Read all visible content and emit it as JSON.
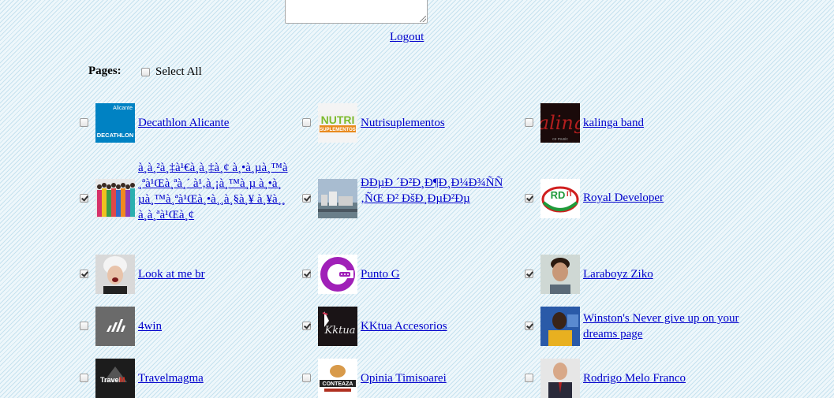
{
  "logout_label": "Logout",
  "pages_label": "Pages:",
  "select_all_label": "Select All",
  "select_all_checked": false,
  "pages": [
    {
      "name": "Decathlon Alicante",
      "checked": false,
      "icon": "decathlon-logo"
    },
    {
      "name": "Nutrisuplementos",
      "checked": false,
      "icon": "nutri-logo"
    },
    {
      "name": "kalinga band",
      "checked": false,
      "icon": "kalinga-logo"
    },
    {
      "name": "à¸à¸²à¸‡à¹€à¸à¸‡à¸¢ à¸•à¸µà¸™à¸ªà¹Œà¸ªà¸´ à¹‚à¸¡à¸™à¸µ à¸•à¸µà¸™à¸ªà¹Œà¸•à¸¸à¸§à¸¥ à¸¥à¸¸à¸à¸ªà¹Œà¸¢",
      "checked": true,
      "icon": "group-photo"
    },
    {
      "name": "ÐÐµÐ ´Ð²Ð¸Ð¶Ð¸Ð¼Ð¾ÑÑ‚ÑŒ Ð² ÐšÐ¸ÐµÐ²Ðµ",
      "checked": true,
      "icon": "building-photo"
    },
    {
      "name": "Royal Developer",
      "checked": true,
      "icon": "royal-dev-logo"
    },
    {
      "name": "Look at me br",
      "checked": true,
      "icon": "person-photo"
    },
    {
      "name": "Punto G",
      "checked": true,
      "icon": "punto-g-logo"
    },
    {
      "name": "Laraboyz Ziko",
      "checked": true,
      "icon": "man-photo"
    },
    {
      "name": "4win",
      "checked": false,
      "icon": "4win-logo"
    },
    {
      "name": "KKtua Accesorios",
      "checked": true,
      "icon": "kktua-logo"
    },
    {
      "name": "Winston's Never give up on your dreams page",
      "checked": true,
      "icon": "winston-photo"
    },
    {
      "name": "Travelmagma",
      "checked": false,
      "icon": "travelmagma-logo"
    },
    {
      "name": "Opinia Timisoarei",
      "checked": false,
      "icon": "opinia-logo"
    },
    {
      "name": "Rodrigo Melo Franco",
      "checked": false,
      "icon": "rodrigo-photo"
    }
  ]
}
